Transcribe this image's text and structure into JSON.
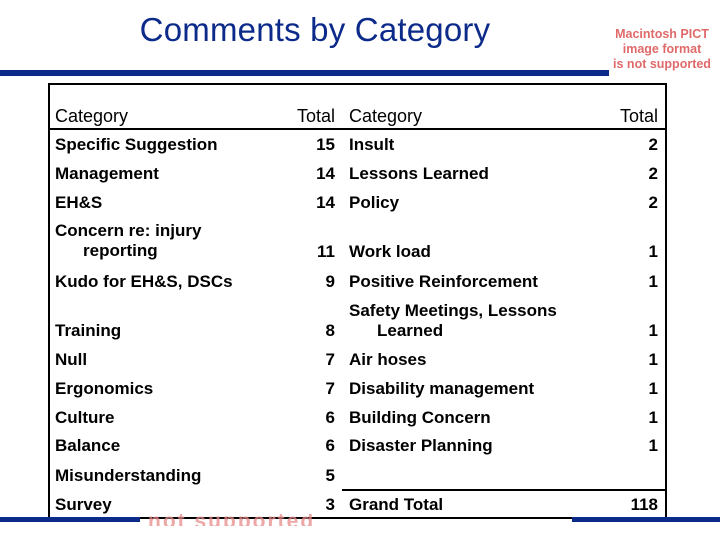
{
  "title": "Comments by Category",
  "image_placeholder": {
    "line1": "Macintosh PICT",
    "line2": "image format",
    "line3": "is not supported",
    "bottom_text": "not supported"
  },
  "colors": {
    "title": "#0b2a8a",
    "bar": "#0b2a8a",
    "placeholder_text": "#e06a6a"
  },
  "table": {
    "headers": {
      "category_left": "Category",
      "total_left": "Total",
      "category_right": "Category",
      "total_right": "Total"
    },
    "left_rows": [
      {
        "category": "Specific Suggestion",
        "total": "15"
      },
      {
        "category": "Management",
        "total": "14"
      },
      {
        "category": "EH&S",
        "total": "14"
      },
      {
        "category_line1": "Concern re: injury",
        "category_line2": "reporting",
        "total": "11"
      },
      {
        "category": "Kudo for EH&S, DSCs",
        "total": "9"
      },
      {
        "category": "Training",
        "total": "8"
      },
      {
        "category": "Null",
        "total": "7"
      },
      {
        "category": "Ergonomics",
        "total": "7"
      },
      {
        "category": "Culture",
        "total": "6"
      },
      {
        "category": "Balance",
        "total": "6"
      },
      {
        "category": "Misunderstanding",
        "total": "5"
      },
      {
        "category": "Survey",
        "total": "3"
      }
    ],
    "right_rows": [
      {
        "category": "Insult",
        "total": "2"
      },
      {
        "category": "Lessons Learned",
        "total": "2"
      },
      {
        "category": "Policy",
        "total": "2"
      },
      {
        "category": "Work load",
        "total": "1"
      },
      {
        "category": "Positive Reinforcement",
        "total": "1"
      },
      {
        "category_line1": "Safety Meetings, Lessons",
        "category_line2": "Learned",
        "total": "1"
      },
      {
        "category": "Air hoses",
        "total": "1"
      },
      {
        "category": "Disability management",
        "total": "1"
      },
      {
        "category": "Building Concern",
        "total": "1"
      },
      {
        "category": "Disaster Planning",
        "total": "1"
      }
    ],
    "grand_total": {
      "label": "Grand Total",
      "value": "118"
    }
  }
}
